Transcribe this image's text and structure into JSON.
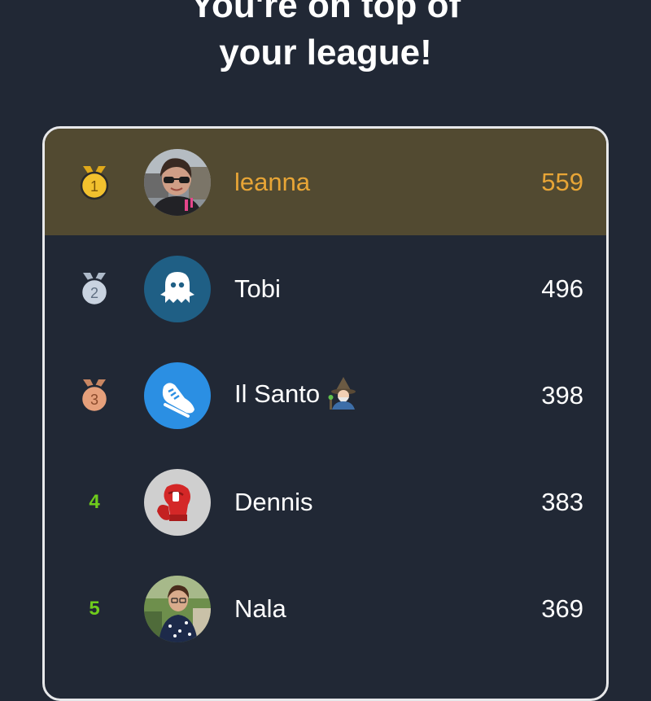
{
  "headline": {
    "line1": "You're on top of",
    "line2": "your league!"
  },
  "leaderboard": [
    {
      "rank": "1",
      "name": "leanna",
      "score": "559",
      "medal": "gold-medal-icon",
      "avatar": "photo-avatar"
    },
    {
      "rank": "2",
      "name": "Tobi",
      "score": "496",
      "medal": "silver-medal-icon",
      "avatar": "ghost-avatar"
    },
    {
      "rank": "3",
      "name": "Il Santo",
      "score": "398",
      "medal": "bronze-medal-icon",
      "avatar": "sneaker-avatar",
      "emoji": "wizard-emoji"
    },
    {
      "rank": "4",
      "name": "Dennis",
      "score": "383",
      "avatar": "boxing-glove-avatar"
    },
    {
      "rank": "5",
      "name": "Nala",
      "score": "369",
      "avatar": "photo-avatar"
    }
  ],
  "colors": {
    "background": "#212835",
    "highlight_row": "#524a31",
    "highlight_text": "#e8a536",
    "rank_number": "#6fcc1c",
    "gold": "#f2c12e",
    "silver": "#c9d3e0",
    "bronze": "#e6a07b",
    "ghost_avatar_bg": "#1f5f85",
    "sneaker_avatar_bg": "#2b8fe3"
  }
}
